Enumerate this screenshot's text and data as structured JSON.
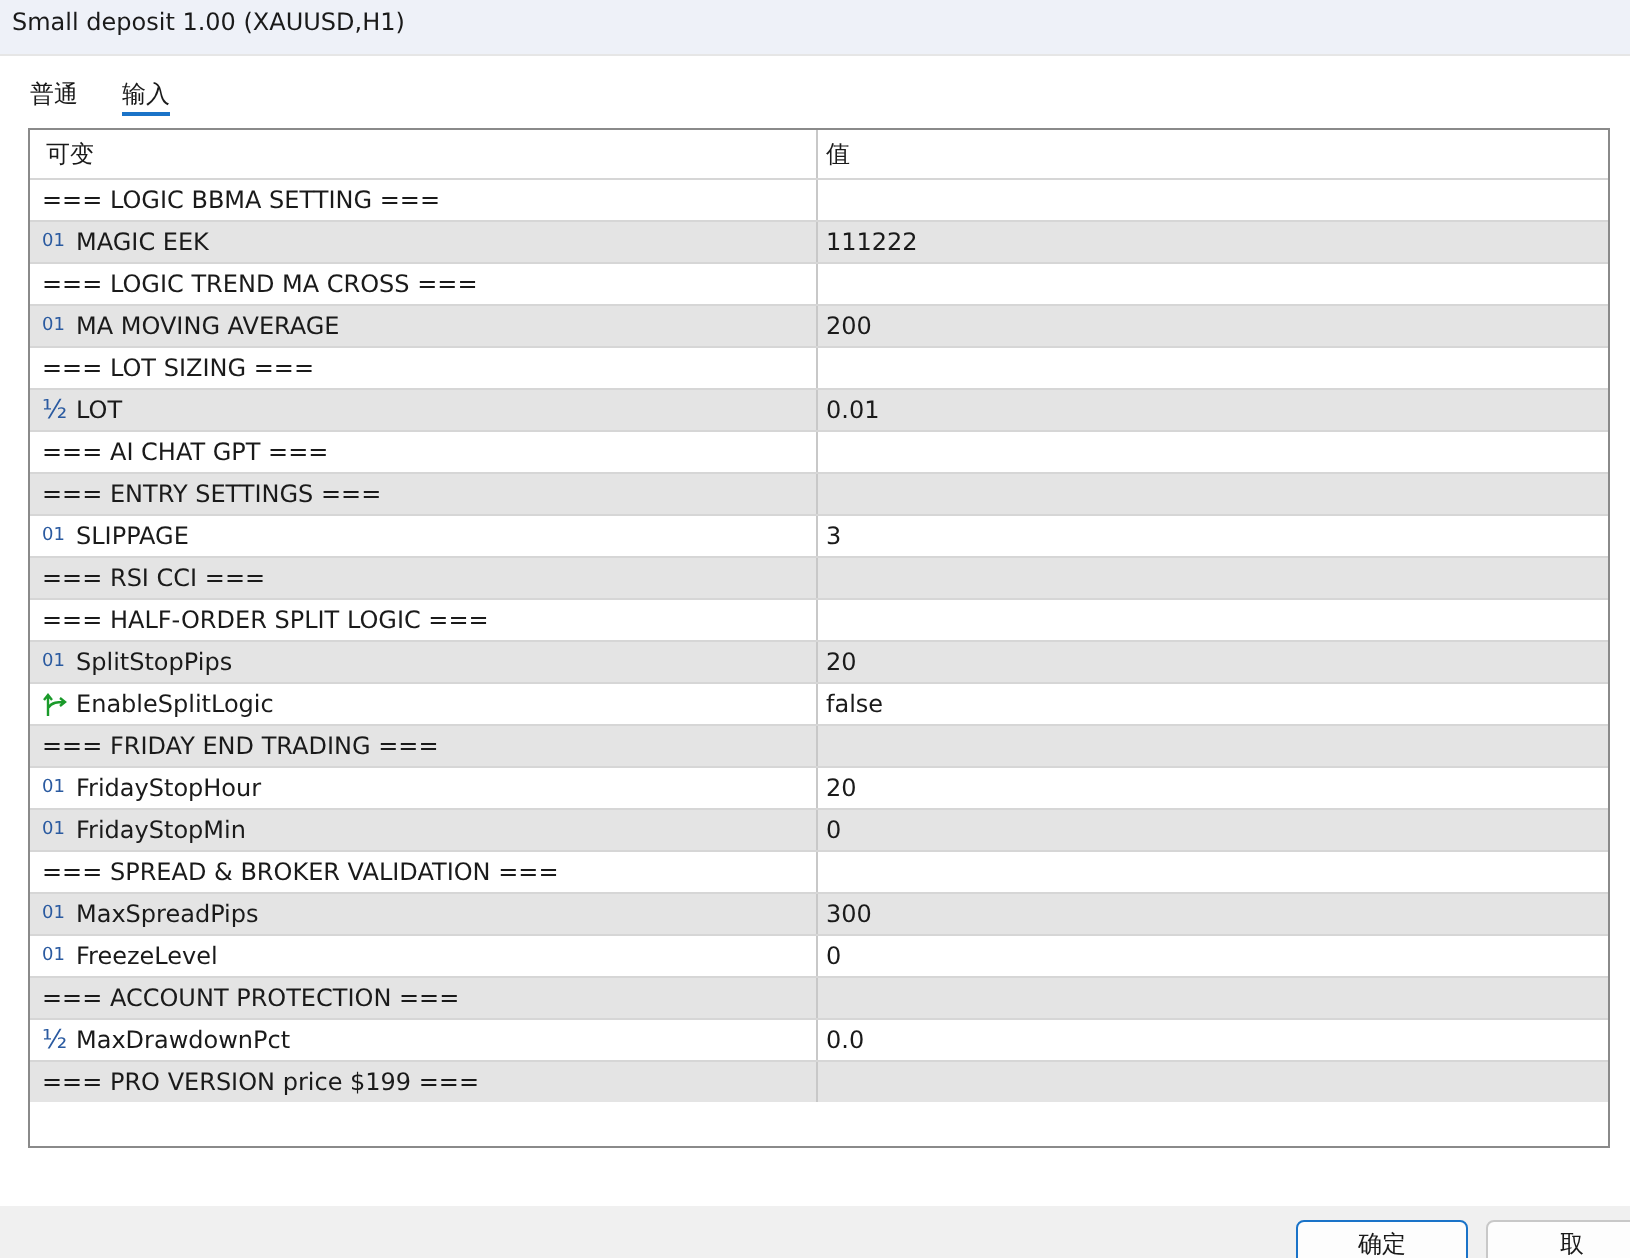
{
  "window": {
    "title": "Small deposit 1.00 (XAUUSD,H1)"
  },
  "tabs": [
    {
      "label": "普通",
      "selected": false
    },
    {
      "label": "输入",
      "selected": true
    }
  ],
  "table": {
    "columns": [
      "可变",
      "值"
    ],
    "rows": [
      {
        "kind": "group",
        "name": "=== LOGIC BBMA SETTING ==="
      },
      {
        "kind": "int",
        "icon": "01",
        "name": "MAGIC EEK",
        "value": "111222"
      },
      {
        "kind": "group",
        "name": "=== LOGIC TREND MA CROSS ==="
      },
      {
        "kind": "int",
        "icon": "01",
        "name": "MA MOVING AVERAGE",
        "value": "200"
      },
      {
        "kind": "group",
        "name": "=== LOT SIZING ==="
      },
      {
        "kind": "double",
        "icon": "½",
        "name": "LOT",
        "value": "0.01"
      },
      {
        "kind": "group",
        "name": "=== AI CHAT GPT ==="
      },
      {
        "kind": "group",
        "name": "=== ENTRY SETTINGS ==="
      },
      {
        "kind": "int",
        "icon": "01",
        "name": "SLIPPAGE",
        "value": "3"
      },
      {
        "kind": "group",
        "name": "=== RSI CCI ==="
      },
      {
        "kind": "group",
        "name": "=== HALF-ORDER SPLIT LOGIC ==="
      },
      {
        "kind": "int",
        "icon": "01",
        "name": "SplitStopPips",
        "value": "20"
      },
      {
        "kind": "bool",
        "name": "EnableSplitLogic",
        "value": "false"
      },
      {
        "kind": "group",
        "name": "=== FRIDAY END TRADING ==="
      },
      {
        "kind": "int",
        "icon": "01",
        "name": "FridayStopHour",
        "value": "20"
      },
      {
        "kind": "int",
        "icon": "01",
        "name": "FridayStopMin",
        "value": "0"
      },
      {
        "kind": "group",
        "name": "=== SPREAD & BROKER VALIDATION ==="
      },
      {
        "kind": "int",
        "icon": "01",
        "name": "MaxSpreadPips",
        "value": "300"
      },
      {
        "kind": "int",
        "icon": "01",
        "name": "FreezeLevel",
        "value": "0"
      },
      {
        "kind": "group",
        "name": "=== ACCOUNT PROTECTION ==="
      },
      {
        "kind": "double",
        "icon": "½",
        "name": "MaxDrawdownPct",
        "value": "0.0"
      },
      {
        "kind": "group",
        "name": "=== PRO VERSION price $199 ==="
      }
    ]
  },
  "buttons": [
    {
      "label": "确定",
      "kind": "default"
    },
    {
      "label": "取",
      "kind": "normal"
    }
  ]
}
